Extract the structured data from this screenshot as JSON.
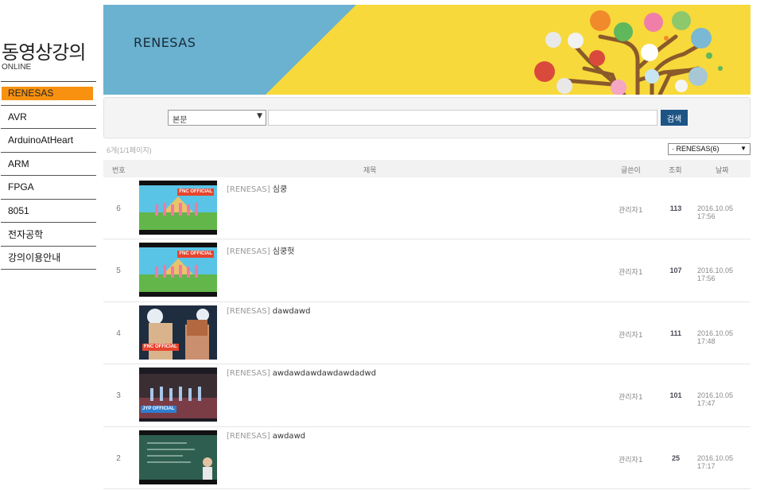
{
  "site": {
    "title": "동영상강의",
    "subtitle": "ONLINE"
  },
  "sidebar": {
    "items": [
      {
        "label": "RENESAS",
        "active": true
      },
      {
        "label": "AVR"
      },
      {
        "label": "ArduinoAtHeart"
      },
      {
        "label": "ARM"
      },
      {
        "label": "FPGA"
      },
      {
        "label": "8051"
      },
      {
        "label": "전자공학"
      },
      {
        "label": "강의이용안내"
      }
    ]
  },
  "banner": {
    "title": "RENESAS",
    "colors": {
      "left": "#6ab2cf",
      "right": "#f7d93b"
    }
  },
  "search": {
    "field_label": "본문",
    "field_arrow": "▼",
    "query": "",
    "button_label": "검색",
    "button_color": "#1c5486"
  },
  "list": {
    "count_text": "6개(1/1페이지)",
    "category_selected": "· RENESAS(6)",
    "category_arrow": "▼",
    "headers": {
      "num": "번호",
      "title": "제목",
      "author": "글쓴이",
      "views": "조회",
      "date": "날짜"
    },
    "rows": [
      {
        "num": "6",
        "prefix": "[RENESAS]",
        "title": "심쿵",
        "author": "관리자1",
        "views": "113",
        "date": "2016.10.05 17:56",
        "thumb_badge": "FNC OFFICIAL"
      },
      {
        "num": "5",
        "prefix": "[RENESAS]",
        "title": "심쿵헛",
        "author": "관리자1",
        "views": "107",
        "date": "2016.10.05 17:56",
        "thumb_badge": "FNC OFFICIAL"
      },
      {
        "num": "4",
        "prefix": "[RENESAS]",
        "title": "dawdawd",
        "author": "관리자1",
        "views": "111",
        "date": "2016.10.05 17:48",
        "thumb_badge": "FNC OFFICIAL"
      },
      {
        "num": "3",
        "prefix": "[RENESAS]",
        "title": "awdawdawdawdawdadwd",
        "author": "관리자1",
        "views": "101",
        "date": "2016.10.05 17:47",
        "thumb_badge": "JYP OFFICIAL"
      },
      {
        "num": "2",
        "prefix": "[RENESAS]",
        "title": "awdawd",
        "author": "관리자1",
        "views": "25",
        "date": "2016.10.05 17:17",
        "thumb_badge": ""
      }
    ]
  }
}
